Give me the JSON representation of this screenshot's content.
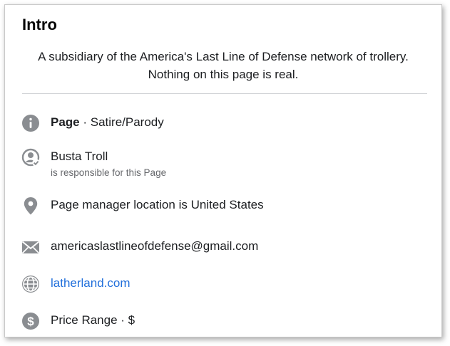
{
  "intro": {
    "title": "Intro",
    "bio_line1": "A subsidiary of the America's Last Line of Defense network of trollery.",
    "bio_line2": "Nothing on this page is real."
  },
  "details": {
    "category_label": "Page",
    "category_value": " · Satire/Parody",
    "owner_name": "Busta Troll",
    "owner_sub": "is responsible for this Page",
    "location": "Page manager location is United States",
    "email": "americaslastlineofdefense@gmail.com",
    "website": "latherland.com",
    "price_range": "Price Range · $"
  },
  "icons": {
    "category": "info-icon",
    "owner": "user-check-icon",
    "location": "location-pin-icon",
    "email": "envelope-icon",
    "website": "globe-icon",
    "price": "dollar-icon"
  },
  "colors": {
    "icon_gray": "#8a8d91",
    "link": "#216fdb",
    "text": "#1c1e21",
    "subtext": "#65676b"
  }
}
